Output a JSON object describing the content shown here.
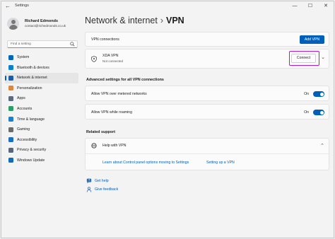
{
  "window": {
    "app_title": "Settings",
    "back_glyph": "←",
    "minimize_glyph": "—",
    "maximize_glyph": "☐",
    "close_glyph": "✕"
  },
  "profile": {
    "name": "Richard Edmonds",
    "email": "contact@richedmonds.co.uk"
  },
  "search": {
    "placeholder": "Find a setting"
  },
  "sidebar": {
    "items": [
      {
        "label": "System",
        "icon": "monitor-icon",
        "color": "#0067c0",
        "active": false
      },
      {
        "label": "Bluetooth & devices",
        "icon": "bluetooth-icon",
        "color": "#0a7fd1",
        "active": false
      },
      {
        "label": "Network & internet",
        "icon": "wifi-icon",
        "color": "#1f5ca8",
        "active": true
      },
      {
        "label": "Personalization",
        "icon": "brush-icon",
        "color": "#e0863a",
        "active": false
      },
      {
        "label": "Apps",
        "icon": "apps-icon",
        "color": "#5a6b7d",
        "active": false
      },
      {
        "label": "Accounts",
        "icon": "person-icon",
        "color": "#2e9c6a",
        "active": false
      },
      {
        "label": "Time & language",
        "icon": "globe-clock-icon",
        "color": "#1d7ec9",
        "active": false
      },
      {
        "label": "Gaming",
        "icon": "controller-icon",
        "color": "#6b6b6b",
        "active": false
      },
      {
        "label": "Accessibility",
        "icon": "accessibility-icon",
        "color": "#1b6ec2",
        "active": false
      },
      {
        "label": "Privacy & security",
        "icon": "shield-icon",
        "color": "#596878",
        "active": false
      },
      {
        "label": "Windows Update",
        "icon": "update-icon",
        "color": "#0f6cbd",
        "active": false
      }
    ]
  },
  "breadcrumb": {
    "parent": "Network & internet",
    "separator": "›",
    "current": "VPN"
  },
  "vpn_connections": {
    "label": "VPN connections",
    "add_button": "Add VPN"
  },
  "vpn_item": {
    "name": "XDA VPN",
    "status": "Not connected",
    "connect_button": "Connect",
    "expand_glyph": "⌄",
    "highlight_color": "#b118d8"
  },
  "advanced": {
    "title": "Advanced settings for all VPN connections",
    "metered": {
      "label": "Allow VPN over metered networks",
      "state": "On",
      "on": true
    },
    "roaming": {
      "label": "Allow VPN while roaming",
      "state": "On",
      "on": true
    }
  },
  "support": {
    "title": "Related support",
    "help_label": "Help with VPN",
    "collapse_glyph": "⌃",
    "links": [
      "Learn about Control panel options moving to Settings",
      "Setting up a VPN"
    ]
  },
  "footer": {
    "get_help": "Get help",
    "feedback": "Give feedback"
  },
  "colors": {
    "accent": "#005fb8",
    "window_bg": "#f3f3f3",
    "card_bg": "#fbfbfb"
  }
}
